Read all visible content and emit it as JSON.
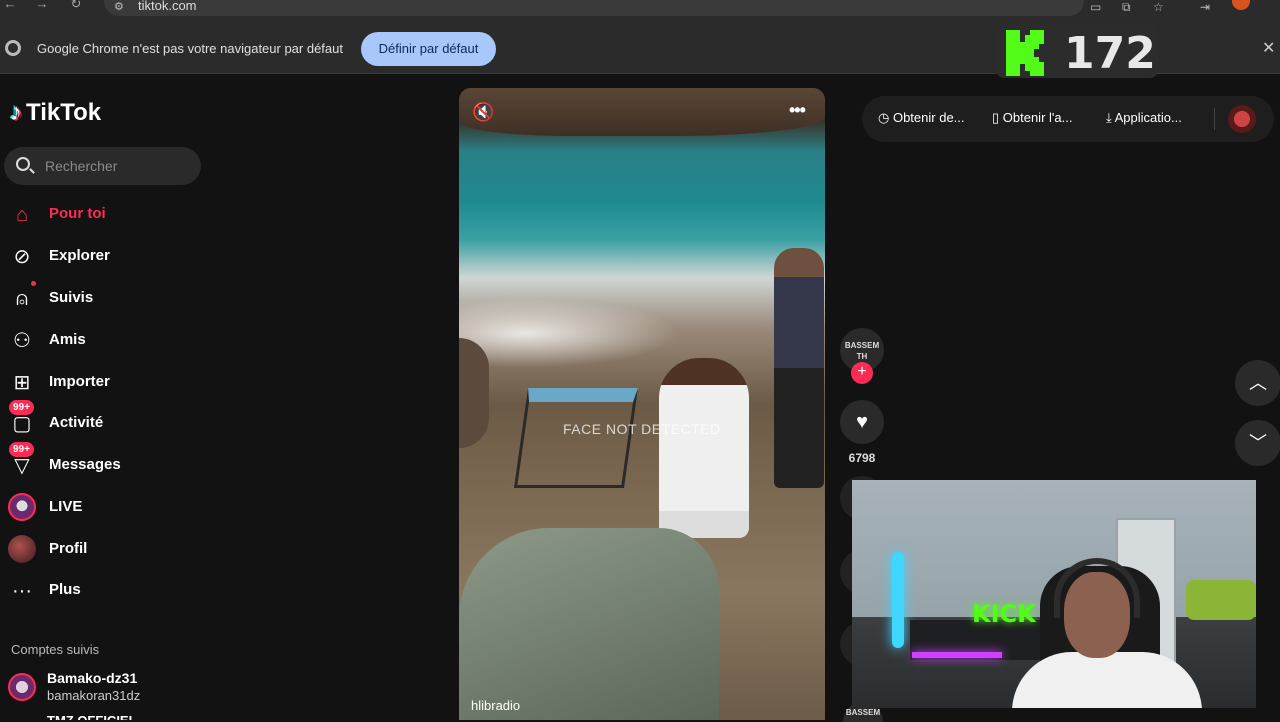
{
  "browser": {
    "url": "tiktok.com",
    "infobar_text": "Google Chrome n'est pas votre navigateur par défaut",
    "infobar_button": "Définir par défaut",
    "infobar_close": "✕"
  },
  "overlay": {
    "kick_count": "172"
  },
  "sidebar": {
    "logo": "TikTok",
    "search_placeholder": "Rechercher",
    "nav": [
      {
        "label": "Pour toi",
        "icon": "home-icon",
        "active": true
      },
      {
        "label": "Explorer",
        "icon": "compass-icon"
      },
      {
        "label": "Suivis",
        "icon": "following-icon"
      },
      {
        "label": "Amis",
        "icon": "friends-icon"
      },
      {
        "label": "Importer",
        "icon": "upload-icon"
      },
      {
        "label": "Activité",
        "icon": "activity-icon",
        "badge": "99+"
      },
      {
        "label": "Messages",
        "icon": "messages-icon",
        "badge": "99+"
      },
      {
        "label": "LIVE",
        "icon": "live-avatar"
      },
      {
        "label": "Profil",
        "icon": "profile-avatar"
      },
      {
        "label": "Plus",
        "icon": "more-icon"
      }
    ],
    "followed_title": "Comptes suivis",
    "followed": [
      {
        "name": "Bamako-dz31",
        "username": "bamakoran31dz"
      },
      {
        "name": "TMZ OFFICIEL"
      }
    ]
  },
  "video": {
    "overlay_text": "FACE NOT DETECTED",
    "author": "hlibradio"
  },
  "topbar": {
    "items": [
      "Obtenir de...",
      "Obtenir l'a...",
      "Applicatio..."
    ]
  },
  "actions": {
    "creator_label": "BASSEM TH",
    "like_count": "6798"
  },
  "colors": {
    "accent": "#fe2c55",
    "kick_green": "#53fc18",
    "infobar_button_bg": "#a8c7fa"
  }
}
